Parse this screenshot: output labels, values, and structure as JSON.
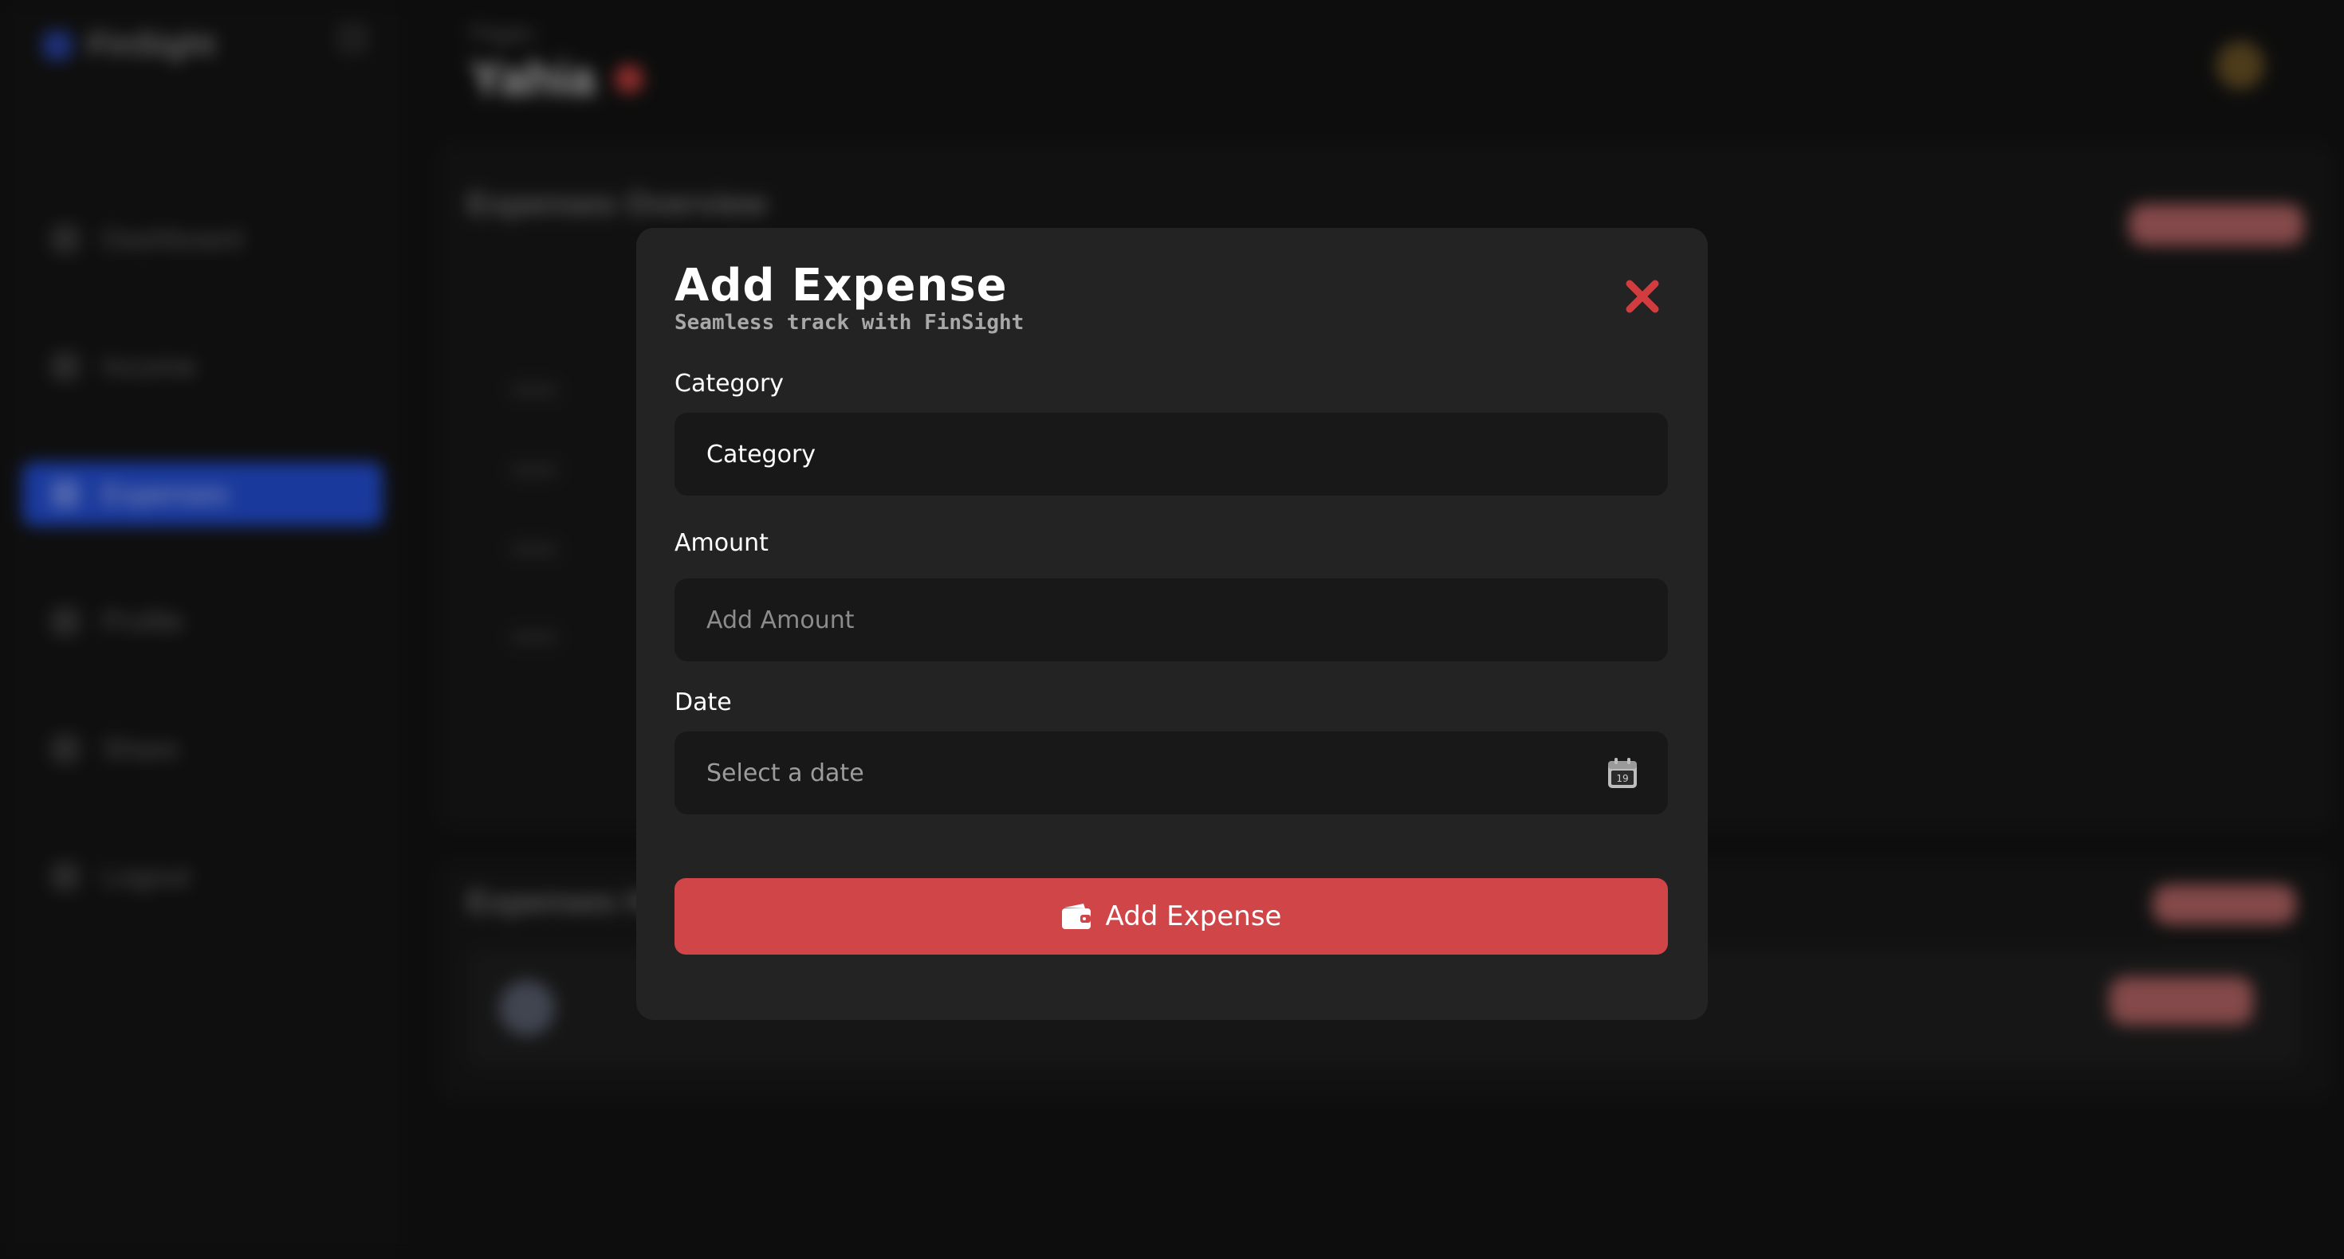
{
  "background_app": {
    "brand": "FinSight",
    "breadcrumb": "Pages",
    "page_title": "Yahia",
    "nav_items": [
      {
        "label": "Dashboard",
        "active": false
      },
      {
        "label": "Income",
        "active": false
      },
      {
        "label": "Expenses",
        "active": true
      },
      {
        "label": "Profile",
        "active": false
      },
      {
        "label": "Share",
        "active": false
      },
      {
        "label": "Logout",
        "active": false
      }
    ],
    "cards": [
      {
        "title": "Expenses Overview"
      },
      {
        "title": "Expenses History"
      }
    ]
  },
  "modal": {
    "title": "Add Expense",
    "subtitle": "Seamless track with FinSight",
    "close_icon": "close-x-icon",
    "fields": {
      "category": {
        "label": "Category",
        "value": "Category"
      },
      "amount": {
        "label": "Amount",
        "placeholder": "Add Amount",
        "value": ""
      },
      "date": {
        "label": "Date",
        "placeholder": "Select a date",
        "calendar_day": "19",
        "icon": "calendar-icon"
      }
    },
    "submit": {
      "label": "Add Expense",
      "icon": "wallet-icon"
    }
  },
  "colors": {
    "accent_red": "#d04548",
    "close_red": "#d23c3f",
    "modal_bg": "#232323",
    "field_bg": "#181818",
    "nav_active": "#2450d9"
  }
}
